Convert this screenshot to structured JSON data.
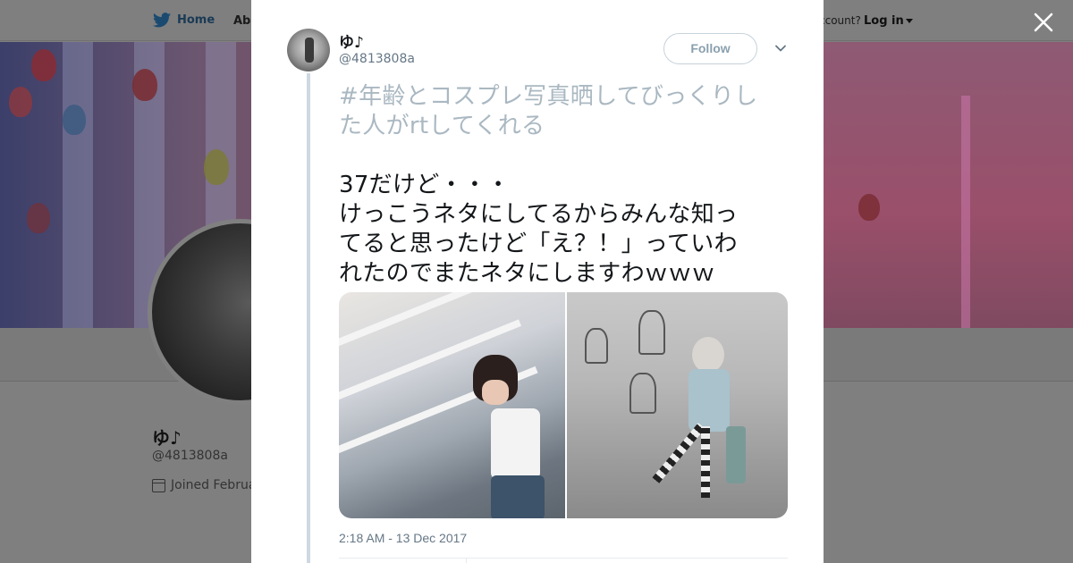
{
  "topbar": {
    "home_label": "Home",
    "about_label": "Abo",
    "account_prompt": "ccount?",
    "login_label": "Log in",
    "twitter_icon": "twitter-bird-icon",
    "brand_color": "#1da1f2"
  },
  "profile": {
    "name": "ゆ♪",
    "handle": "@4813808a",
    "joined": "Joined Februa"
  },
  "modal": {
    "close_icon": "close-icon",
    "author": {
      "name": "ゆ♪",
      "handle": "@4813808a"
    },
    "follow_label": "Follow",
    "more_icon": "chevron-down-icon",
    "tweet": {
      "hashtag_line1": "#年齢とコスプレ写真晒してびっくりし",
      "hashtag_line2": "た人がrtしてくれる",
      "line1": "37だけど・・・",
      "line2": "けっこうネタにしてるからみんな知っ",
      "line3": "てると思ったけど「え？！」っていわ",
      "line4": "れたのでまたネタにしますわｗｗｗ"
    },
    "media": [
      "photo-1",
      "photo-2"
    ],
    "timestamp": "2:18 AM - 13 Dec 2017"
  }
}
